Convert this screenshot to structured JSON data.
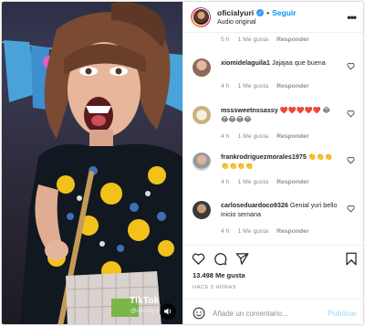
{
  "post": {
    "username": "oficialyuri",
    "follow_label": "Seguir",
    "separator": "•",
    "audio_label": "Audio original",
    "more_label": "•••"
  },
  "media": {
    "watermark_brand": "TikTok",
    "watermark_user": "@oficialyuri"
  },
  "top_meta": {
    "time": "5 h",
    "likes": "1 Me gusta",
    "reply": "Responder"
  },
  "comments": [
    {
      "user": "xiomidelaguila1",
      "text": "Jajajaa que buena",
      "time": "4 h",
      "likes": "1 Me gusta",
      "reply": "Responder"
    },
    {
      "user": "msssweetnssassy",
      "text": "❤️❤️❤️❤️❤️ 😂😂😂😂😂",
      "time": "4 h",
      "likes": "1 Me gusta",
      "reply": "Responder"
    },
    {
      "user": "frankrodriguezmorales1975",
      "text": "👏👏👏👏👏👏👏",
      "time": "4 h",
      "likes": "1 Me gusta",
      "reply": "Responder"
    },
    {
      "user": "carloseduardoco9326",
      "text": "Genial yuri bello inicio semana",
      "time": "4 h",
      "likes": "1 Me gusta",
      "reply": "Responder"
    }
  ],
  "actions": {
    "likes_count": "13.498 Me gusta",
    "date": "HACE 5 HORAS",
    "comment_placeholder": "Añade un comentario...",
    "publish_label": "Publicar"
  },
  "colors": {
    "accent_blue": "#0095f6",
    "muted": "#8e8e8e",
    "publish_disabled": "#b2dffc"
  }
}
